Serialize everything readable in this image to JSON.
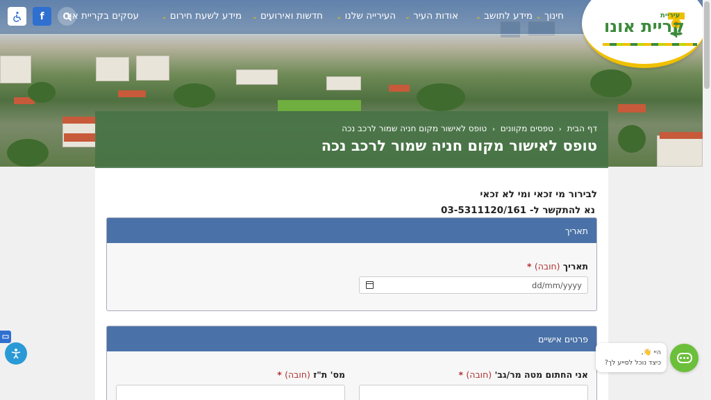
{
  "nav": {
    "items": [
      {
        "label": "חינוך"
      },
      {
        "label": "מידע לתושב"
      },
      {
        "label": "אודות העיר"
      },
      {
        "label": "העירייה שלנו"
      },
      {
        "label": "חדשות ואירועים"
      },
      {
        "label": "מידע לשעת חירום"
      },
      {
        "label": "עסקים בקריית אונו"
      }
    ],
    "facebook_label": "f",
    "icons": {
      "accessibility": "wheelchair-icon",
      "search": "search-icon",
      "chevron": "chevron-down-icon"
    }
  },
  "logo": {
    "small_text": "עיריית",
    "big_text": "קריית אונו"
  },
  "breadcrumb": {
    "home": "דף הבית",
    "forms": "טפסים מקוונים",
    "current": "טופס לאישור מקום חניה שמור לרכב נכה"
  },
  "page": {
    "title": "טופס לאישור מקום חניה שמור לרכב נכה"
  },
  "intro": {
    "line1": "לבירור מי זכאי ומי לא זכאי",
    "line2": "נא להתקשר ל- 03-5311120/161"
  },
  "sections": {
    "date": {
      "header": "תאריך",
      "label": "תאריך",
      "required_text": "(חובה)",
      "star": "*",
      "placeholder": "dd/mm/yyyy"
    },
    "personal": {
      "header": "פרטים אישיים",
      "name_label": "אני החתום מטה מר/גב'",
      "id_label": "מס' ת\"ז",
      "required_text": "(חובה)",
      "star": "*"
    }
  },
  "chat": {
    "line1": "היי 👋,",
    "line2": "כיצד נוכל לסייע לך?"
  },
  "colors": {
    "nav_bg": "#3c6496",
    "banner_bg": "#467346",
    "section_head": "#4a72a8",
    "chat_green": "#6bbf3a",
    "logo_green": "#3b8a3b",
    "accent_yellow": "#f0c000"
  }
}
